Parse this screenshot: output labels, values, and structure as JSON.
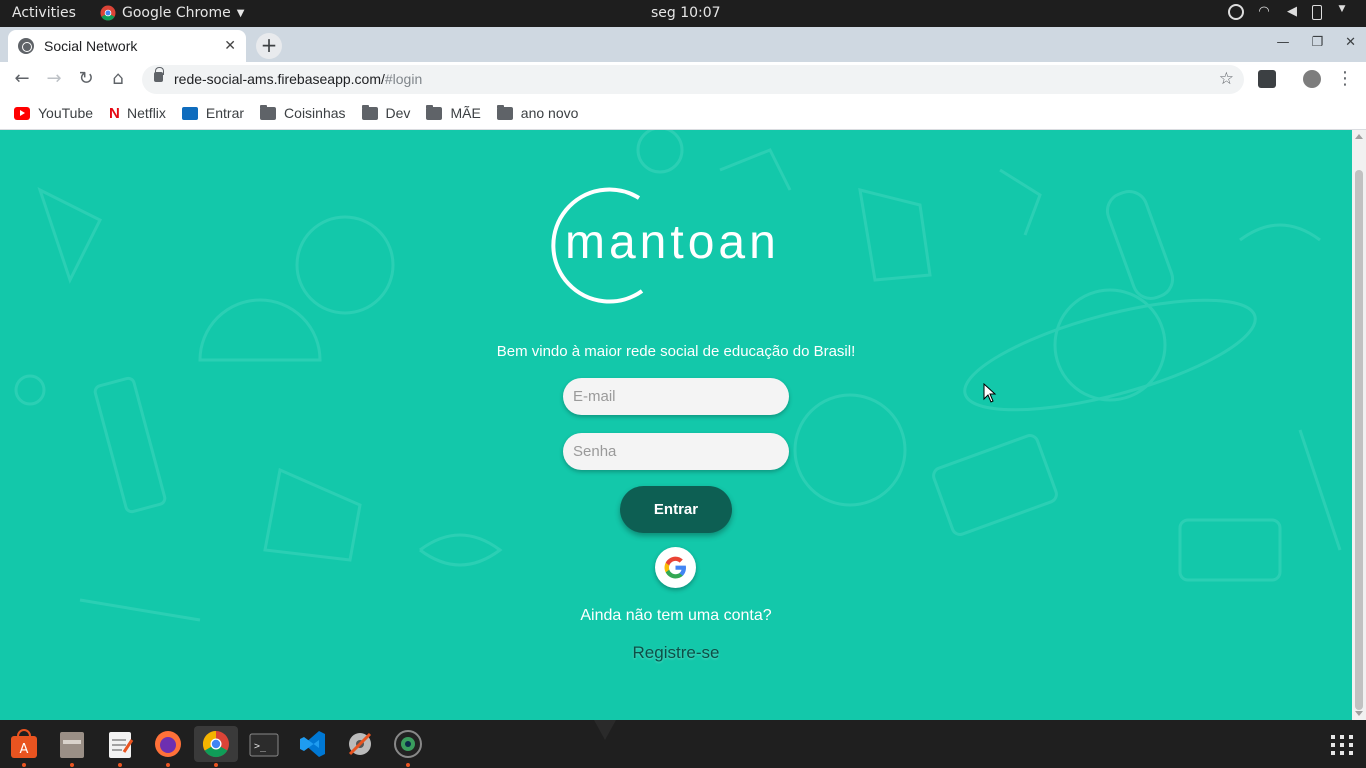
{
  "system_bar": {
    "activities": "Activities",
    "app_name": "Google Chrome",
    "clock": "seg 10:07"
  },
  "browser": {
    "tab_title": "Social Network",
    "url_host": "rede-social-ams.firebaseapp.com/",
    "url_fragment": "#login",
    "bookmarks": [
      "YouTube",
      "Netflix",
      "Entrar",
      "Coisinhas",
      "Dev",
      "MÃE",
      "ano novo"
    ]
  },
  "page": {
    "logo_text": "mantoan",
    "welcome": "Bem vindo à maior rede social de educação do Brasil!",
    "email_placeholder": "E-mail",
    "password_placeholder": "Senha",
    "login_button": "Entrar",
    "no_account": "Ainda não tem uma conta?",
    "register_link": "Registre-se"
  },
  "colors": {
    "page_background": "#13c8aa",
    "button": "#0d5f53",
    "link": "#0d4f47"
  },
  "dock": {
    "apps": [
      "ubuntu-software-icon",
      "files-icon",
      "text-editor-icon",
      "firefox-icon",
      "chrome-icon",
      "terminal-icon",
      "vscode-icon",
      "settings-tool-icon",
      "camera-app-icon"
    ]
  }
}
